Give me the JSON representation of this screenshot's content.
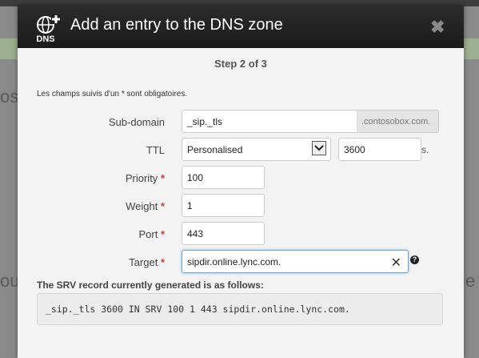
{
  "modal": {
    "title": "Add an entry to the DNS zone",
    "logo_text": "DNS",
    "close_glyph": "✖"
  },
  "form": {
    "step": "Step 2 of 3",
    "required_note": "Les champs suivis d'un * sont obligatoires.",
    "subdomain": {
      "label": "Sub-domain",
      "value": "_sip._tls",
      "suffix": ".contosobox.com."
    },
    "ttl": {
      "label": "TTL",
      "select_value": "Personalised",
      "value": "3600",
      "unit": "s."
    },
    "priority": {
      "label": "Priority",
      "value": "100"
    },
    "weight": {
      "label": "Weight",
      "value": "1"
    },
    "port": {
      "label": "Port",
      "value": "443"
    },
    "target": {
      "label": "Target",
      "value": "sipdir.online.lync.com."
    },
    "required_marker": "*"
  },
  "record": {
    "label": "The SRV record currently generated is as follows:",
    "value": "_sip._tls 3600 IN SRV 100 1 443 sipdir.online.lync.com."
  },
  "colors": {
    "header": "#222222",
    "required": "#d23a3a",
    "focus": "#6aa6d8"
  }
}
